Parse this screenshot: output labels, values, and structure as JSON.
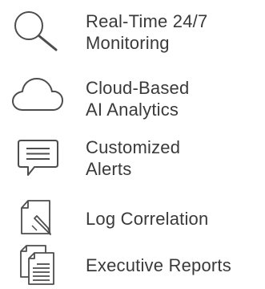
{
  "features": [
    {
      "icon": "search-icon",
      "lines": [
        "Real-Time 24/7",
        "Monitoring"
      ]
    },
    {
      "icon": "cloud-icon",
      "lines": [
        "Cloud-Based",
        "AI Analytics"
      ]
    },
    {
      "icon": "chat-message-icon",
      "lines": [
        "Customized",
        "Alerts"
      ]
    },
    {
      "icon": "document-pen-icon",
      "lines": [
        "Log Correlation"
      ]
    },
    {
      "icon": "documents-icon",
      "lines": [
        "Executive Reports"
      ]
    }
  ],
  "colors": {
    "icon": "#4d4d4d",
    "text": "#3a3a3a",
    "background": "#ffffff"
  }
}
